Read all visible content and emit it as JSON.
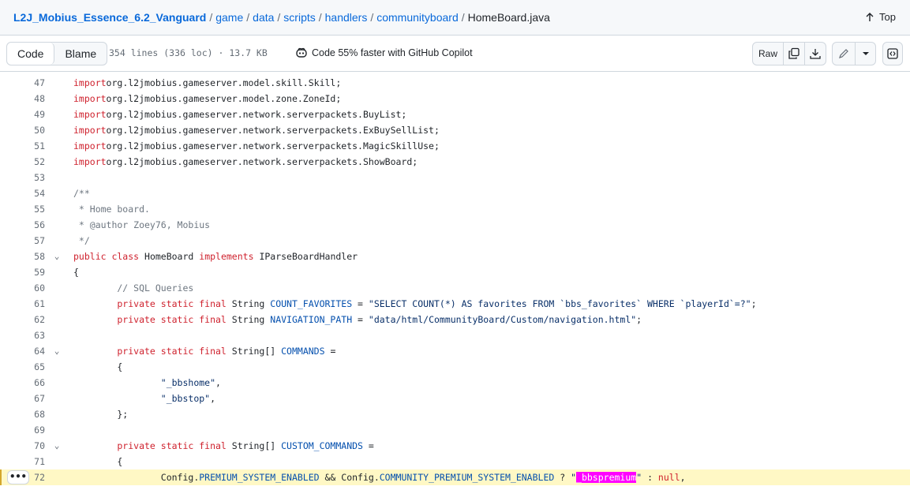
{
  "breadcrumb": {
    "repo": "L2J_Mobius_Essence_6.2_Vanguard",
    "parts": [
      "game",
      "data",
      "scripts",
      "handlers",
      "communityboard"
    ],
    "file": "HomeBoard.java"
  },
  "top_link": "Top",
  "toolbar": {
    "code_label": "Code",
    "blame_label": "Blame",
    "meta": "354 lines (336 loc) · 13.7 KB",
    "copilot": "Code 55% faster with GitHub Copilot",
    "raw_label": "Raw"
  },
  "icons": {
    "up": "arrow-up-icon",
    "copilot": "copilot-icon",
    "copy": "copy-icon",
    "download": "download-icon",
    "edit": "pencil-icon",
    "more": "triangle-down-icon",
    "symbols": "code-square-icon"
  },
  "colors": {
    "link": "#0969da",
    "keyword": "#cf222e",
    "constant": "#0550ae",
    "string": "#0a3069",
    "comment": "#6e7781",
    "highlight_line": "#fff8c5",
    "search_mark": "#ff00ff"
  },
  "lines": [
    {
      "n": "47",
      "fold": false,
      "src": [
        [
          "kw",
          "import"
        ],
        [
          "",
          "org.l2jmobius.gameserver.model.skill.Skill;"
        ]
      ]
    },
    {
      "n": "48",
      "fold": false,
      "src": [
        [
          "kw",
          "import"
        ],
        [
          "",
          "org.l2jmobius.gameserver.model.zone.ZoneId;"
        ]
      ]
    },
    {
      "n": "49",
      "fold": false,
      "src": [
        [
          "kw",
          "import"
        ],
        [
          "",
          "org.l2jmobius.gameserver.network.serverpackets.BuyList;"
        ]
      ]
    },
    {
      "n": "50",
      "fold": false,
      "src": [
        [
          "kw",
          "import"
        ],
        [
          "",
          "org.l2jmobius.gameserver.network.serverpackets.ExBuySellList;"
        ]
      ]
    },
    {
      "n": "51",
      "fold": false,
      "src": [
        [
          "kw",
          "import"
        ],
        [
          "",
          "org.l2jmobius.gameserver.network.serverpackets.MagicSkillUse;"
        ]
      ]
    },
    {
      "n": "52",
      "fold": false,
      "src": [
        [
          "kw",
          "import"
        ],
        [
          "",
          "org.l2jmobius.gameserver.network.serverpackets.ShowBoard;"
        ]
      ]
    },
    {
      "n": "53",
      "fold": false,
      "src": []
    },
    {
      "n": "54",
      "fold": false,
      "src": [
        [
          "cm",
          "/**"
        ]
      ]
    },
    {
      "n": "55",
      "fold": false,
      "src": [
        [
          "cm",
          " * Home board."
        ]
      ]
    },
    {
      "n": "56",
      "fold": false,
      "src": [
        [
          "cm",
          " * @author Zoey76, Mobius"
        ]
      ]
    },
    {
      "n": "57",
      "fold": false,
      "src": [
        [
          "cm",
          " */"
        ]
      ]
    },
    {
      "n": "58",
      "fold": true,
      "src": [
        [
          "kw",
          "public class"
        ],
        [
          "",
          " HomeBoard "
        ],
        [
          "kw",
          "implements"
        ],
        [
          "",
          " IParseBoardHandler"
        ]
      ]
    },
    {
      "n": "59",
      "fold": false,
      "src": [
        [
          "",
          "{"
        ]
      ]
    },
    {
      "n": "60",
      "fold": false,
      "src": [
        [
          "cm",
          "        // SQL Queries"
        ]
      ]
    },
    {
      "n": "61",
      "fold": false,
      "src": [
        [
          "kw",
          "        private static final"
        ],
        [
          "",
          " String "
        ],
        [
          "cn",
          "COUNT_FAVORITES"
        ],
        [
          "",
          " = "
        ],
        [
          "st",
          "\"SELECT COUNT(*) AS favorites FROM `bbs_favorites` WHERE `playerId`=?\""
        ],
        [
          "",
          ";"
        ]
      ]
    },
    {
      "n": "62",
      "fold": false,
      "src": [
        [
          "kw",
          "        private static final"
        ],
        [
          "",
          " String "
        ],
        [
          "cn",
          "NAVIGATION_PATH"
        ],
        [
          "",
          " = "
        ],
        [
          "st",
          "\"data/html/CommunityBoard/Custom/navigation.html\""
        ],
        [
          "",
          ";"
        ]
      ]
    },
    {
      "n": "63",
      "fold": false,
      "src": []
    },
    {
      "n": "64",
      "fold": true,
      "src": [
        [
          "kw",
          "        private static final"
        ],
        [
          "",
          " String[] "
        ],
        [
          "cn",
          "COMMANDS"
        ],
        [
          "",
          " ="
        ]
      ]
    },
    {
      "n": "65",
      "fold": false,
      "src": [
        [
          "",
          "        {"
        ]
      ]
    },
    {
      "n": "66",
      "fold": false,
      "src": [
        [
          "st",
          "                \"_bbshome\""
        ],
        [
          "",
          ","
        ]
      ]
    },
    {
      "n": "67",
      "fold": false,
      "src": [
        [
          "st",
          "                \"_bbstop\""
        ],
        [
          "",
          ","
        ]
      ]
    },
    {
      "n": "68",
      "fold": false,
      "src": [
        [
          "",
          "        };"
        ]
      ]
    },
    {
      "n": "69",
      "fold": false,
      "src": []
    },
    {
      "n": "70",
      "fold": true,
      "src": [
        [
          "kw",
          "        private static final"
        ],
        [
          "",
          " String[] "
        ],
        [
          "cn",
          "CUSTOM_COMMANDS"
        ],
        [
          "",
          " ="
        ]
      ]
    },
    {
      "n": "71",
      "fold": false,
      "src": [
        [
          "",
          "        {"
        ]
      ]
    },
    {
      "n": "72",
      "fold": false,
      "highlight": true,
      "src": [
        [
          "",
          "                Config."
        ],
        [
          "cn",
          "PREMIUM_SYSTEM_ENABLED"
        ],
        [
          "",
          " && Config."
        ],
        [
          "cn",
          "COMMUNITY_PREMIUM_SYSTEM_ENABLED"
        ],
        [
          "",
          " ? "
        ],
        [
          "st",
          "\""
        ],
        [
          "mark",
          "_bbspremium"
        ],
        [
          "st",
          "\""
        ],
        [
          "",
          " : "
        ],
        [
          "kw",
          "null"
        ],
        [
          "",
          ","
        ]
      ]
    }
  ]
}
